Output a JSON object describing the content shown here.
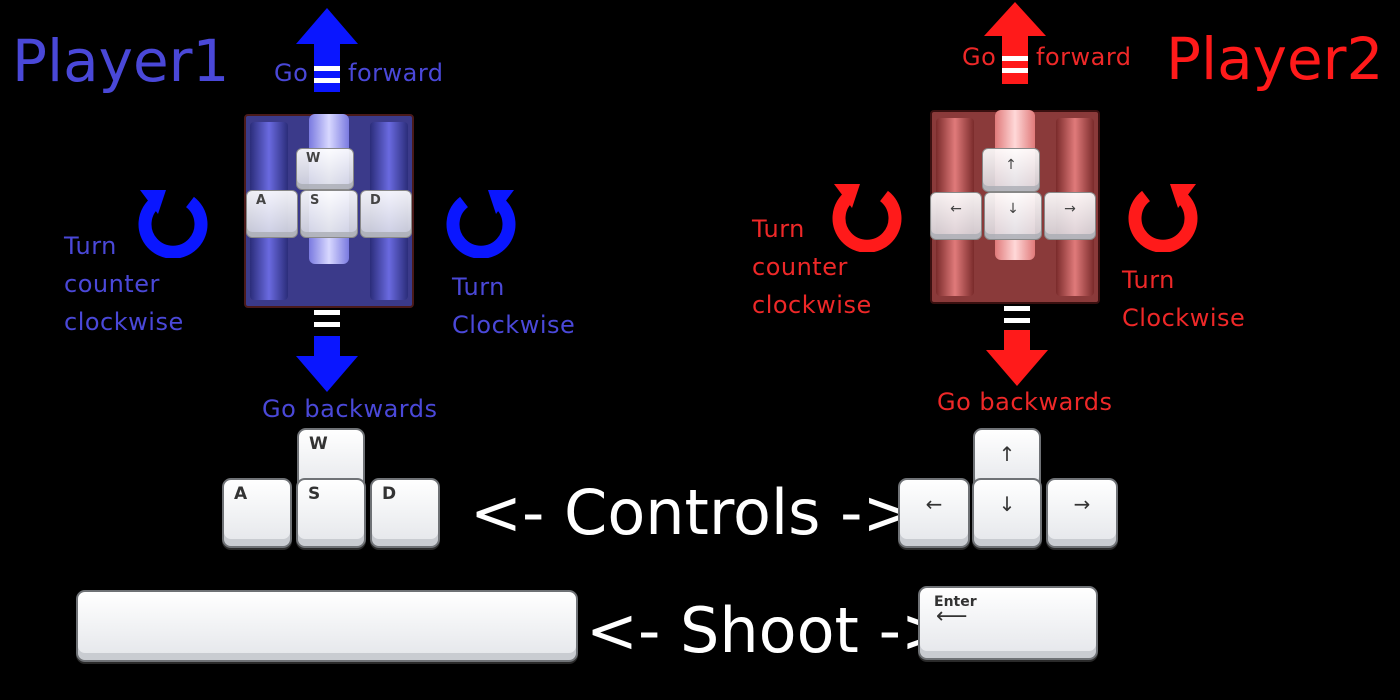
{
  "colors": {
    "player1": "#0a16ff",
    "player1_text": "#4a48d8",
    "player2": "#ff1a1a",
    "player2_text": "#ee2828",
    "background": "#000000"
  },
  "player1": {
    "title": "Player1",
    "forward": [
      "Go",
      "forward"
    ],
    "backward": "Go backwards",
    "turn_ccw": [
      "Turn",
      "counter",
      "clockwise"
    ],
    "turn_cw": [
      "Turn",
      "Clockwise"
    ],
    "tank_keys": [
      "W",
      "A",
      "S",
      "D"
    ]
  },
  "player2": {
    "title": "Player2",
    "forward": [
      "Go",
      "forward"
    ],
    "backward": "Go backwards",
    "turn_ccw": [
      "Turn",
      "counter",
      "clockwise"
    ],
    "turn_cw": [
      "Turn",
      "Clockwise"
    ],
    "tank_keys": [
      "↑",
      "←",
      "↓",
      "→"
    ]
  },
  "controls": {
    "label": "<- Controls ->",
    "p1_keys": [
      "W",
      "A",
      "S",
      "D"
    ],
    "p2_keys": [
      "↑",
      "←",
      "↓",
      "→"
    ]
  },
  "shoot": {
    "label": "<- Shoot ->",
    "enter_label": "Enter",
    "enter_arrow": "⟵"
  },
  "icons": [
    "arrow-up-icon",
    "arrow-down-icon",
    "rotate-ccw-icon",
    "rotate-cw-icon",
    "tank-icon",
    "keyboard-key-icon"
  ]
}
